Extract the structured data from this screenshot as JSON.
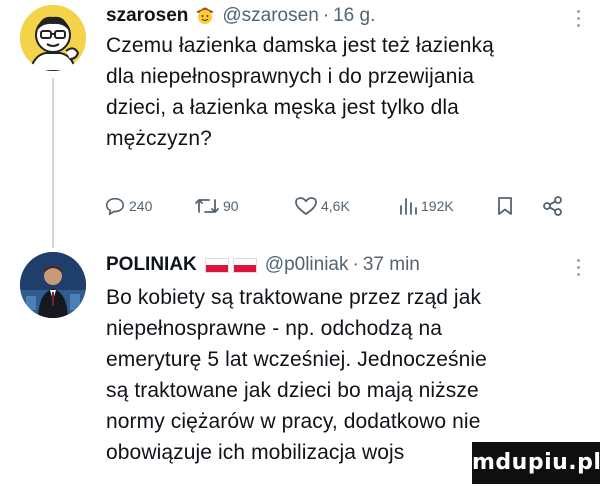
{
  "tweets": [
    {
      "author": {
        "name": "szarosen",
        "handle": "@szarosen",
        "time": "16 g.",
        "badge": "cowboy-face-emoji"
      },
      "text_lines": [
        "Czemu łazienka damska jest też łazienką",
        "dla niepełnosprawnych i do przewijania",
        "dzieci, a łazienka męska jest tylko dla",
        "mężczyzn?"
      ],
      "actions": {
        "replies": "240",
        "retweets": "90",
        "likes": "4,6K",
        "views": "192K"
      }
    },
    {
      "author": {
        "name": "POLINIAK",
        "handle": "@p0liniak",
        "time": "37 min",
        "badge": "poland-flags"
      },
      "text_lines": [
        "Bo kobiety są traktowane przez rząd jak",
        "niepełnosprawne - np. odchodzą na",
        "emeryturę 5 lat wcześniej. Jednocześnie",
        "są traktowane jak dzieci bo mają niższe",
        "normy ciężarów w pracy, dodatkowo nie",
        "obowiązuje ich mobilizacja wojs"
      ]
    }
  ],
  "watermark": "mdupiu.pl",
  "separator": "·"
}
